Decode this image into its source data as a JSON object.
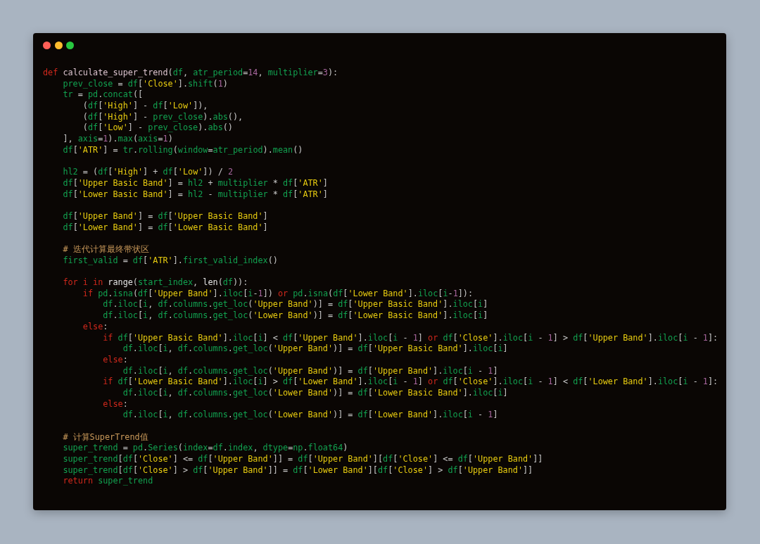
{
  "window_controls": [
    {
      "color": "#fe5f57"
    },
    {
      "color": "#febc2e"
    },
    {
      "color": "#28c840"
    }
  ],
  "code": [
    {
      "kind": "code",
      "tokens": [
        {
          "kind": "k",
          "text": "def "
        },
        {
          "kind": "f",
          "text": "calculate_super_trend"
        },
        {
          "kind": "p",
          "text": "("
        },
        {
          "kind": "n",
          "text": "df"
        },
        {
          "kind": "p",
          "text": ", "
        },
        {
          "kind": "n",
          "text": "atr_period"
        },
        {
          "kind": "p",
          "text": "="
        },
        {
          "kind": "m",
          "text": "14"
        },
        {
          "kind": "p",
          "text": ", "
        },
        {
          "kind": "n",
          "text": "multiplier"
        },
        {
          "kind": "p",
          "text": "="
        },
        {
          "kind": "m",
          "text": "3"
        },
        {
          "kind": "p",
          "text": "):"
        }
      ]
    },
    {
      "kind": "code",
      "tokens": [
        {
          "kind": "n",
          "text": "    prev_close"
        },
        {
          "kind": "p",
          "text": " = "
        },
        {
          "kind": "n",
          "text": "df"
        },
        {
          "kind": "p",
          "text": "["
        },
        {
          "kind": "s",
          "text": "'Close'"
        },
        {
          "kind": "p",
          "text": "]."
        },
        {
          "kind": "n",
          "text": "shift"
        },
        {
          "kind": "p",
          "text": "("
        },
        {
          "kind": "m",
          "text": "1"
        },
        {
          "kind": "p",
          "text": ")"
        }
      ]
    },
    {
      "kind": "code",
      "tokens": [
        {
          "kind": "n",
          "text": "    tr"
        },
        {
          "kind": "p",
          "text": " = "
        },
        {
          "kind": "n",
          "text": "pd"
        },
        {
          "kind": "p",
          "text": "."
        },
        {
          "kind": "n",
          "text": "concat"
        },
        {
          "kind": "p",
          "text": "(["
        }
      ]
    },
    {
      "kind": "code",
      "tokens": [
        {
          "kind": "p",
          "text": "        ("
        },
        {
          "kind": "n",
          "text": "df"
        },
        {
          "kind": "p",
          "text": "["
        },
        {
          "kind": "s",
          "text": "'High'"
        },
        {
          "kind": "p",
          "text": "] - "
        },
        {
          "kind": "n",
          "text": "df"
        },
        {
          "kind": "p",
          "text": "["
        },
        {
          "kind": "s",
          "text": "'Low'"
        },
        {
          "kind": "p",
          "text": "]),"
        }
      ]
    },
    {
      "kind": "code",
      "tokens": [
        {
          "kind": "p",
          "text": "        ("
        },
        {
          "kind": "n",
          "text": "df"
        },
        {
          "kind": "p",
          "text": "["
        },
        {
          "kind": "s",
          "text": "'High'"
        },
        {
          "kind": "p",
          "text": "] - "
        },
        {
          "kind": "n",
          "text": "prev_close"
        },
        {
          "kind": "p",
          "text": ")."
        },
        {
          "kind": "n",
          "text": "abs"
        },
        {
          "kind": "p",
          "text": "(),"
        }
      ]
    },
    {
      "kind": "code",
      "tokens": [
        {
          "kind": "p",
          "text": "        ("
        },
        {
          "kind": "n",
          "text": "df"
        },
        {
          "kind": "p",
          "text": "["
        },
        {
          "kind": "s",
          "text": "'Low'"
        },
        {
          "kind": "p",
          "text": "] - "
        },
        {
          "kind": "n",
          "text": "prev_close"
        },
        {
          "kind": "p",
          "text": ")."
        },
        {
          "kind": "n",
          "text": "abs"
        },
        {
          "kind": "p",
          "text": "()"
        }
      ]
    },
    {
      "kind": "code",
      "tokens": [
        {
          "kind": "p",
          "text": "    ], "
        },
        {
          "kind": "n",
          "text": "axis"
        },
        {
          "kind": "p",
          "text": "="
        },
        {
          "kind": "m",
          "text": "1"
        },
        {
          "kind": "p",
          "text": ")."
        },
        {
          "kind": "n",
          "text": "max"
        },
        {
          "kind": "p",
          "text": "("
        },
        {
          "kind": "n",
          "text": "axis"
        },
        {
          "kind": "p",
          "text": "="
        },
        {
          "kind": "m",
          "text": "1"
        },
        {
          "kind": "p",
          "text": ")"
        }
      ]
    },
    {
      "kind": "code",
      "tokens": [
        {
          "kind": "n",
          "text": "    df"
        },
        {
          "kind": "p",
          "text": "["
        },
        {
          "kind": "s",
          "text": "'ATR'"
        },
        {
          "kind": "p",
          "text": "] = "
        },
        {
          "kind": "n",
          "text": "tr"
        },
        {
          "kind": "p",
          "text": "."
        },
        {
          "kind": "n",
          "text": "rolling"
        },
        {
          "kind": "p",
          "text": "("
        },
        {
          "kind": "n",
          "text": "window"
        },
        {
          "kind": "p",
          "text": "="
        },
        {
          "kind": "n",
          "text": "atr_period"
        },
        {
          "kind": "p",
          "text": ")."
        },
        {
          "kind": "n",
          "text": "mean"
        },
        {
          "kind": "p",
          "text": "()"
        }
      ]
    },
    {
      "kind": "blank"
    },
    {
      "kind": "code",
      "tokens": [
        {
          "kind": "n",
          "text": "    hl2"
        },
        {
          "kind": "p",
          "text": " = ("
        },
        {
          "kind": "n",
          "text": "df"
        },
        {
          "kind": "p",
          "text": "["
        },
        {
          "kind": "s",
          "text": "'High'"
        },
        {
          "kind": "p",
          "text": "] + "
        },
        {
          "kind": "n",
          "text": "df"
        },
        {
          "kind": "p",
          "text": "["
        },
        {
          "kind": "s",
          "text": "'Low'"
        },
        {
          "kind": "p",
          "text": "]) / "
        },
        {
          "kind": "m",
          "text": "2"
        }
      ]
    },
    {
      "kind": "code",
      "tokens": [
        {
          "kind": "n",
          "text": "    df"
        },
        {
          "kind": "p",
          "text": "["
        },
        {
          "kind": "s",
          "text": "'Upper Basic Band'"
        },
        {
          "kind": "p",
          "text": "] = "
        },
        {
          "kind": "n",
          "text": "hl2"
        },
        {
          "kind": "p",
          "text": " + "
        },
        {
          "kind": "n",
          "text": "multiplier"
        },
        {
          "kind": "p",
          "text": " * "
        },
        {
          "kind": "n",
          "text": "df"
        },
        {
          "kind": "p",
          "text": "["
        },
        {
          "kind": "s",
          "text": "'ATR'"
        },
        {
          "kind": "p",
          "text": "]"
        }
      ]
    },
    {
      "kind": "code",
      "tokens": [
        {
          "kind": "n",
          "text": "    df"
        },
        {
          "kind": "p",
          "text": "["
        },
        {
          "kind": "s",
          "text": "'Lower Basic Band'"
        },
        {
          "kind": "p",
          "text": "] = "
        },
        {
          "kind": "n",
          "text": "hl2"
        },
        {
          "kind": "p",
          "text": " - "
        },
        {
          "kind": "n",
          "text": "multiplier"
        },
        {
          "kind": "p",
          "text": " * "
        },
        {
          "kind": "n",
          "text": "df"
        },
        {
          "kind": "p",
          "text": "["
        },
        {
          "kind": "s",
          "text": "'ATR'"
        },
        {
          "kind": "p",
          "text": "]"
        }
      ]
    },
    {
      "kind": "blank"
    },
    {
      "kind": "code",
      "tokens": [
        {
          "kind": "n",
          "text": "    df"
        },
        {
          "kind": "p",
          "text": "["
        },
        {
          "kind": "s",
          "text": "'Upper Band'"
        },
        {
          "kind": "p",
          "text": "] = "
        },
        {
          "kind": "n",
          "text": "df"
        },
        {
          "kind": "p",
          "text": "["
        },
        {
          "kind": "s",
          "text": "'Upper Basic Band'"
        },
        {
          "kind": "p",
          "text": "]"
        }
      ]
    },
    {
      "kind": "code",
      "tokens": [
        {
          "kind": "n",
          "text": "    df"
        },
        {
          "kind": "p",
          "text": "["
        },
        {
          "kind": "s",
          "text": "'Lower Band'"
        },
        {
          "kind": "p",
          "text": "] = "
        },
        {
          "kind": "n",
          "text": "df"
        },
        {
          "kind": "p",
          "text": "["
        },
        {
          "kind": "s",
          "text": "'Lower Basic Band'"
        },
        {
          "kind": "p",
          "text": "]"
        }
      ]
    },
    {
      "kind": "blank"
    },
    {
      "kind": "code",
      "tokens": [
        {
          "kind": "c",
          "text": "    # 迭代计算最终带状区"
        }
      ]
    },
    {
      "kind": "code",
      "tokens": [
        {
          "kind": "n",
          "text": "    first_valid"
        },
        {
          "kind": "p",
          "text": " = "
        },
        {
          "kind": "n",
          "text": "df"
        },
        {
          "kind": "p",
          "text": "["
        },
        {
          "kind": "s",
          "text": "'ATR'"
        },
        {
          "kind": "p",
          "text": "]."
        },
        {
          "kind": "n",
          "text": "first_valid_index"
        },
        {
          "kind": "p",
          "text": "()"
        }
      ]
    },
    {
      "kind": "blank"
    },
    {
      "kind": "code",
      "tokens": [
        {
          "kind": "k",
          "text": "    for i in "
        },
        {
          "kind": "b",
          "text": "range"
        },
        {
          "kind": "p",
          "text": "("
        },
        {
          "kind": "n",
          "text": "start_index"
        },
        {
          "kind": "p",
          "text": ", "
        },
        {
          "kind": "b",
          "text": "len"
        },
        {
          "kind": "p",
          "text": "("
        },
        {
          "kind": "n",
          "text": "df"
        },
        {
          "kind": "p",
          "text": ")):"
        }
      ]
    },
    {
      "kind": "code",
      "tokens": [
        {
          "kind": "k",
          "text": "        if "
        },
        {
          "kind": "n",
          "text": "pd"
        },
        {
          "kind": "p",
          "text": "."
        },
        {
          "kind": "n",
          "text": "isna"
        },
        {
          "kind": "p",
          "text": "("
        },
        {
          "kind": "n",
          "text": "df"
        },
        {
          "kind": "p",
          "text": "["
        },
        {
          "kind": "s",
          "text": "'Upper Band'"
        },
        {
          "kind": "p",
          "text": "]."
        },
        {
          "kind": "n",
          "text": "iloc"
        },
        {
          "kind": "p",
          "text": "["
        },
        {
          "kind": "n",
          "text": "i"
        },
        {
          "kind": "p",
          "text": "-"
        },
        {
          "kind": "m",
          "text": "1"
        },
        {
          "kind": "p",
          "text": "]) "
        },
        {
          "kind": "k",
          "text": "or "
        },
        {
          "kind": "n",
          "text": "pd"
        },
        {
          "kind": "p",
          "text": "."
        },
        {
          "kind": "n",
          "text": "isna"
        },
        {
          "kind": "p",
          "text": "("
        },
        {
          "kind": "n",
          "text": "df"
        },
        {
          "kind": "p",
          "text": "["
        },
        {
          "kind": "s",
          "text": "'Lower Band'"
        },
        {
          "kind": "p",
          "text": "]."
        },
        {
          "kind": "n",
          "text": "iloc"
        },
        {
          "kind": "p",
          "text": "["
        },
        {
          "kind": "n",
          "text": "i"
        },
        {
          "kind": "p",
          "text": "-"
        },
        {
          "kind": "m",
          "text": "1"
        },
        {
          "kind": "p",
          "text": "]):"
        }
      ]
    },
    {
      "kind": "code",
      "tokens": [
        {
          "kind": "n",
          "text": "            df"
        },
        {
          "kind": "p",
          "text": "."
        },
        {
          "kind": "n",
          "text": "iloc"
        },
        {
          "kind": "p",
          "text": "["
        },
        {
          "kind": "n",
          "text": "i"
        },
        {
          "kind": "p",
          "text": ", "
        },
        {
          "kind": "n",
          "text": "df"
        },
        {
          "kind": "p",
          "text": "."
        },
        {
          "kind": "n",
          "text": "columns"
        },
        {
          "kind": "p",
          "text": "."
        },
        {
          "kind": "n",
          "text": "get_loc"
        },
        {
          "kind": "p",
          "text": "("
        },
        {
          "kind": "s",
          "text": "'Upper Band'"
        },
        {
          "kind": "p",
          "text": ")] = "
        },
        {
          "kind": "n",
          "text": "df"
        },
        {
          "kind": "p",
          "text": "["
        },
        {
          "kind": "s",
          "text": "'Upper Basic Band'"
        },
        {
          "kind": "p",
          "text": "]."
        },
        {
          "kind": "n",
          "text": "iloc"
        },
        {
          "kind": "p",
          "text": "["
        },
        {
          "kind": "n",
          "text": "i"
        },
        {
          "kind": "p",
          "text": "]"
        }
      ]
    },
    {
      "kind": "code",
      "tokens": [
        {
          "kind": "n",
          "text": "            df"
        },
        {
          "kind": "p",
          "text": "."
        },
        {
          "kind": "n",
          "text": "iloc"
        },
        {
          "kind": "p",
          "text": "["
        },
        {
          "kind": "n",
          "text": "i"
        },
        {
          "kind": "p",
          "text": ", "
        },
        {
          "kind": "n",
          "text": "df"
        },
        {
          "kind": "p",
          "text": "."
        },
        {
          "kind": "n",
          "text": "columns"
        },
        {
          "kind": "p",
          "text": "."
        },
        {
          "kind": "n",
          "text": "get_loc"
        },
        {
          "kind": "p",
          "text": "("
        },
        {
          "kind": "s",
          "text": "'Lower Band'"
        },
        {
          "kind": "p",
          "text": ")] = "
        },
        {
          "kind": "n",
          "text": "df"
        },
        {
          "kind": "p",
          "text": "["
        },
        {
          "kind": "s",
          "text": "'Lower Basic Band'"
        },
        {
          "kind": "p",
          "text": "]."
        },
        {
          "kind": "n",
          "text": "iloc"
        },
        {
          "kind": "p",
          "text": "["
        },
        {
          "kind": "n",
          "text": "i"
        },
        {
          "kind": "p",
          "text": "]"
        }
      ]
    },
    {
      "kind": "code",
      "tokens": [
        {
          "kind": "k",
          "text": "        else"
        },
        {
          "kind": "p",
          "text": ":"
        }
      ]
    },
    {
      "kind": "code",
      "tokens": [
        {
          "kind": "k",
          "text": "            if "
        },
        {
          "kind": "n",
          "text": "df"
        },
        {
          "kind": "p",
          "text": "["
        },
        {
          "kind": "s",
          "text": "'Upper Basic Band'"
        },
        {
          "kind": "p",
          "text": "]."
        },
        {
          "kind": "n",
          "text": "iloc"
        },
        {
          "kind": "p",
          "text": "["
        },
        {
          "kind": "n",
          "text": "i"
        },
        {
          "kind": "p",
          "text": "] < "
        },
        {
          "kind": "n",
          "text": "df"
        },
        {
          "kind": "p",
          "text": "["
        },
        {
          "kind": "s",
          "text": "'Upper Band'"
        },
        {
          "kind": "p",
          "text": "]."
        },
        {
          "kind": "n",
          "text": "iloc"
        },
        {
          "kind": "p",
          "text": "["
        },
        {
          "kind": "n",
          "text": "i"
        },
        {
          "kind": "p",
          "text": " - "
        },
        {
          "kind": "m",
          "text": "1"
        },
        {
          "kind": "p",
          "text": "] "
        },
        {
          "kind": "k",
          "text": "or "
        },
        {
          "kind": "n",
          "text": "df"
        },
        {
          "kind": "p",
          "text": "["
        },
        {
          "kind": "s",
          "text": "'Close'"
        },
        {
          "kind": "p",
          "text": "]."
        },
        {
          "kind": "n",
          "text": "iloc"
        },
        {
          "kind": "p",
          "text": "["
        },
        {
          "kind": "n",
          "text": "i"
        },
        {
          "kind": "p",
          "text": " - "
        },
        {
          "kind": "m",
          "text": "1"
        },
        {
          "kind": "p",
          "text": "] > "
        },
        {
          "kind": "n",
          "text": "df"
        },
        {
          "kind": "p",
          "text": "["
        },
        {
          "kind": "s",
          "text": "'Upper Band'"
        },
        {
          "kind": "p",
          "text": "]."
        },
        {
          "kind": "n",
          "text": "iloc"
        },
        {
          "kind": "p",
          "text": "["
        },
        {
          "kind": "n",
          "text": "i"
        },
        {
          "kind": "p",
          "text": " - "
        },
        {
          "kind": "m",
          "text": "1"
        },
        {
          "kind": "p",
          "text": "]:"
        }
      ]
    },
    {
      "kind": "code",
      "tokens": [
        {
          "kind": "n",
          "text": "                df"
        },
        {
          "kind": "p",
          "text": "."
        },
        {
          "kind": "n",
          "text": "iloc"
        },
        {
          "kind": "p",
          "text": "["
        },
        {
          "kind": "n",
          "text": "i"
        },
        {
          "kind": "p",
          "text": ", "
        },
        {
          "kind": "n",
          "text": "df"
        },
        {
          "kind": "p",
          "text": "."
        },
        {
          "kind": "n",
          "text": "columns"
        },
        {
          "kind": "p",
          "text": "."
        },
        {
          "kind": "n",
          "text": "get_loc"
        },
        {
          "kind": "p",
          "text": "("
        },
        {
          "kind": "s",
          "text": "'Upper Band'"
        },
        {
          "kind": "p",
          "text": ")] = "
        },
        {
          "kind": "n",
          "text": "df"
        },
        {
          "kind": "p",
          "text": "["
        },
        {
          "kind": "s",
          "text": "'Upper Basic Band'"
        },
        {
          "kind": "p",
          "text": "]."
        },
        {
          "kind": "n",
          "text": "iloc"
        },
        {
          "kind": "p",
          "text": "["
        },
        {
          "kind": "n",
          "text": "i"
        },
        {
          "kind": "p",
          "text": "]"
        }
      ]
    },
    {
      "kind": "code",
      "tokens": [
        {
          "kind": "k",
          "text": "            else"
        },
        {
          "kind": "p",
          "text": ":"
        }
      ]
    },
    {
      "kind": "code",
      "tokens": [
        {
          "kind": "n",
          "text": "                df"
        },
        {
          "kind": "p",
          "text": "."
        },
        {
          "kind": "n",
          "text": "iloc"
        },
        {
          "kind": "p",
          "text": "["
        },
        {
          "kind": "n",
          "text": "i"
        },
        {
          "kind": "p",
          "text": ", "
        },
        {
          "kind": "n",
          "text": "df"
        },
        {
          "kind": "p",
          "text": "."
        },
        {
          "kind": "n",
          "text": "columns"
        },
        {
          "kind": "p",
          "text": "."
        },
        {
          "kind": "n",
          "text": "get_loc"
        },
        {
          "kind": "p",
          "text": "("
        },
        {
          "kind": "s",
          "text": "'Upper Band'"
        },
        {
          "kind": "p",
          "text": ")] = "
        },
        {
          "kind": "n",
          "text": "df"
        },
        {
          "kind": "p",
          "text": "["
        },
        {
          "kind": "s",
          "text": "'Upper Band'"
        },
        {
          "kind": "p",
          "text": "]."
        },
        {
          "kind": "n",
          "text": "iloc"
        },
        {
          "kind": "p",
          "text": "["
        },
        {
          "kind": "n",
          "text": "i"
        },
        {
          "kind": "p",
          "text": " - "
        },
        {
          "kind": "m",
          "text": "1"
        },
        {
          "kind": "p",
          "text": "]"
        }
      ]
    },
    {
      "kind": "code",
      "tokens": [
        {
          "kind": "k",
          "text": "            if "
        },
        {
          "kind": "n",
          "text": "df"
        },
        {
          "kind": "p",
          "text": "["
        },
        {
          "kind": "s",
          "text": "'Lower Basic Band'"
        },
        {
          "kind": "p",
          "text": "]."
        },
        {
          "kind": "n",
          "text": "iloc"
        },
        {
          "kind": "p",
          "text": "["
        },
        {
          "kind": "n",
          "text": "i"
        },
        {
          "kind": "p",
          "text": "] > "
        },
        {
          "kind": "n",
          "text": "df"
        },
        {
          "kind": "p",
          "text": "["
        },
        {
          "kind": "s",
          "text": "'Lower Band'"
        },
        {
          "kind": "p",
          "text": "]."
        },
        {
          "kind": "n",
          "text": "iloc"
        },
        {
          "kind": "p",
          "text": "["
        },
        {
          "kind": "n",
          "text": "i"
        },
        {
          "kind": "p",
          "text": " - "
        },
        {
          "kind": "m",
          "text": "1"
        },
        {
          "kind": "p",
          "text": "] "
        },
        {
          "kind": "k",
          "text": "or "
        },
        {
          "kind": "n",
          "text": "df"
        },
        {
          "kind": "p",
          "text": "["
        },
        {
          "kind": "s",
          "text": "'Close'"
        },
        {
          "kind": "p",
          "text": "]."
        },
        {
          "kind": "n",
          "text": "iloc"
        },
        {
          "kind": "p",
          "text": "["
        },
        {
          "kind": "n",
          "text": "i"
        },
        {
          "kind": "p",
          "text": " - "
        },
        {
          "kind": "m",
          "text": "1"
        },
        {
          "kind": "p",
          "text": "] < "
        },
        {
          "kind": "n",
          "text": "df"
        },
        {
          "kind": "p",
          "text": "["
        },
        {
          "kind": "s",
          "text": "'Lower Band'"
        },
        {
          "kind": "p",
          "text": "]."
        },
        {
          "kind": "n",
          "text": "iloc"
        },
        {
          "kind": "p",
          "text": "["
        },
        {
          "kind": "n",
          "text": "i"
        },
        {
          "kind": "p",
          "text": " - "
        },
        {
          "kind": "m",
          "text": "1"
        },
        {
          "kind": "p",
          "text": "]:"
        }
      ]
    },
    {
      "kind": "code",
      "tokens": [
        {
          "kind": "n",
          "text": "                df"
        },
        {
          "kind": "p",
          "text": "."
        },
        {
          "kind": "n",
          "text": "iloc"
        },
        {
          "kind": "p",
          "text": "["
        },
        {
          "kind": "n",
          "text": "i"
        },
        {
          "kind": "p",
          "text": ", "
        },
        {
          "kind": "n",
          "text": "df"
        },
        {
          "kind": "p",
          "text": "."
        },
        {
          "kind": "n",
          "text": "columns"
        },
        {
          "kind": "p",
          "text": "."
        },
        {
          "kind": "n",
          "text": "get_loc"
        },
        {
          "kind": "p",
          "text": "("
        },
        {
          "kind": "s",
          "text": "'Lower Band'"
        },
        {
          "kind": "p",
          "text": ")] = "
        },
        {
          "kind": "n",
          "text": "df"
        },
        {
          "kind": "p",
          "text": "["
        },
        {
          "kind": "s",
          "text": "'Lower Basic Band'"
        },
        {
          "kind": "p",
          "text": "]."
        },
        {
          "kind": "n",
          "text": "iloc"
        },
        {
          "kind": "p",
          "text": "["
        },
        {
          "kind": "n",
          "text": "i"
        },
        {
          "kind": "p",
          "text": "]"
        }
      ]
    },
    {
      "kind": "code",
      "tokens": [
        {
          "kind": "k",
          "text": "            else"
        },
        {
          "kind": "p",
          "text": ":"
        }
      ]
    },
    {
      "kind": "code",
      "tokens": [
        {
          "kind": "n",
          "text": "                df"
        },
        {
          "kind": "p",
          "text": "."
        },
        {
          "kind": "n",
          "text": "iloc"
        },
        {
          "kind": "p",
          "text": "["
        },
        {
          "kind": "n",
          "text": "i"
        },
        {
          "kind": "p",
          "text": ", "
        },
        {
          "kind": "n",
          "text": "df"
        },
        {
          "kind": "p",
          "text": "."
        },
        {
          "kind": "n",
          "text": "columns"
        },
        {
          "kind": "p",
          "text": "."
        },
        {
          "kind": "n",
          "text": "get_loc"
        },
        {
          "kind": "p",
          "text": "("
        },
        {
          "kind": "s",
          "text": "'Lower Band'"
        },
        {
          "kind": "p",
          "text": ")] = "
        },
        {
          "kind": "n",
          "text": "df"
        },
        {
          "kind": "p",
          "text": "["
        },
        {
          "kind": "s",
          "text": "'Lower Band'"
        },
        {
          "kind": "p",
          "text": "]."
        },
        {
          "kind": "n",
          "text": "iloc"
        },
        {
          "kind": "p",
          "text": "["
        },
        {
          "kind": "n",
          "text": "i"
        },
        {
          "kind": "p",
          "text": " - "
        },
        {
          "kind": "m",
          "text": "1"
        },
        {
          "kind": "p",
          "text": "]"
        }
      ]
    },
    {
      "kind": "blank"
    },
    {
      "kind": "code",
      "tokens": [
        {
          "kind": "c",
          "text": "    # 计算SuperTrend值"
        }
      ]
    },
    {
      "kind": "code",
      "tokens": [
        {
          "kind": "n",
          "text": "    super_trend"
        },
        {
          "kind": "p",
          "text": " = "
        },
        {
          "kind": "n",
          "text": "pd"
        },
        {
          "kind": "p",
          "text": "."
        },
        {
          "kind": "n",
          "text": "Series"
        },
        {
          "kind": "p",
          "text": "("
        },
        {
          "kind": "n",
          "text": "index"
        },
        {
          "kind": "p",
          "text": "="
        },
        {
          "kind": "n",
          "text": "df"
        },
        {
          "kind": "p",
          "text": "."
        },
        {
          "kind": "n",
          "text": "index"
        },
        {
          "kind": "p",
          "text": ", "
        },
        {
          "kind": "n",
          "text": "dtype"
        },
        {
          "kind": "p",
          "text": "="
        },
        {
          "kind": "n",
          "text": "np"
        },
        {
          "kind": "p",
          "text": "."
        },
        {
          "kind": "n",
          "text": "float64"
        },
        {
          "kind": "p",
          "text": ")"
        }
      ]
    },
    {
      "kind": "code",
      "tokens": [
        {
          "kind": "n",
          "text": "    super_trend"
        },
        {
          "kind": "p",
          "text": "["
        },
        {
          "kind": "n",
          "text": "df"
        },
        {
          "kind": "p",
          "text": "["
        },
        {
          "kind": "s",
          "text": "'Close'"
        },
        {
          "kind": "p",
          "text": "] <= "
        },
        {
          "kind": "n",
          "text": "df"
        },
        {
          "kind": "p",
          "text": "["
        },
        {
          "kind": "s",
          "text": "'Upper Band'"
        },
        {
          "kind": "p",
          "text": "]] = "
        },
        {
          "kind": "n",
          "text": "df"
        },
        {
          "kind": "p",
          "text": "["
        },
        {
          "kind": "s",
          "text": "'Upper Band'"
        },
        {
          "kind": "p",
          "text": "]["
        },
        {
          "kind": "n",
          "text": "df"
        },
        {
          "kind": "p",
          "text": "["
        },
        {
          "kind": "s",
          "text": "'Close'"
        },
        {
          "kind": "p",
          "text": "] <= "
        },
        {
          "kind": "n",
          "text": "df"
        },
        {
          "kind": "p",
          "text": "["
        },
        {
          "kind": "s",
          "text": "'Upper Band'"
        },
        {
          "kind": "p",
          "text": "]]"
        }
      ]
    },
    {
      "kind": "code",
      "tokens": [
        {
          "kind": "n",
          "text": "    super_trend"
        },
        {
          "kind": "p",
          "text": "["
        },
        {
          "kind": "n",
          "text": "df"
        },
        {
          "kind": "p",
          "text": "["
        },
        {
          "kind": "s",
          "text": "'Close'"
        },
        {
          "kind": "p",
          "text": "] > "
        },
        {
          "kind": "n",
          "text": "df"
        },
        {
          "kind": "p",
          "text": "["
        },
        {
          "kind": "s",
          "text": "'Upper Band'"
        },
        {
          "kind": "p",
          "text": "]] = "
        },
        {
          "kind": "n",
          "text": "df"
        },
        {
          "kind": "p",
          "text": "["
        },
        {
          "kind": "s",
          "text": "'Lower Band'"
        },
        {
          "kind": "p",
          "text": "]["
        },
        {
          "kind": "n",
          "text": "df"
        },
        {
          "kind": "p",
          "text": "["
        },
        {
          "kind": "s",
          "text": "'Close'"
        },
        {
          "kind": "p",
          "text": "] > "
        },
        {
          "kind": "n",
          "text": "df"
        },
        {
          "kind": "p",
          "text": "["
        },
        {
          "kind": "s",
          "text": "'Upper Band'"
        },
        {
          "kind": "p",
          "text": "]]"
        }
      ]
    },
    {
      "kind": "code",
      "tokens": [
        {
          "kind": "k",
          "text": "    return "
        },
        {
          "kind": "n",
          "text": "super_trend"
        }
      ]
    }
  ]
}
